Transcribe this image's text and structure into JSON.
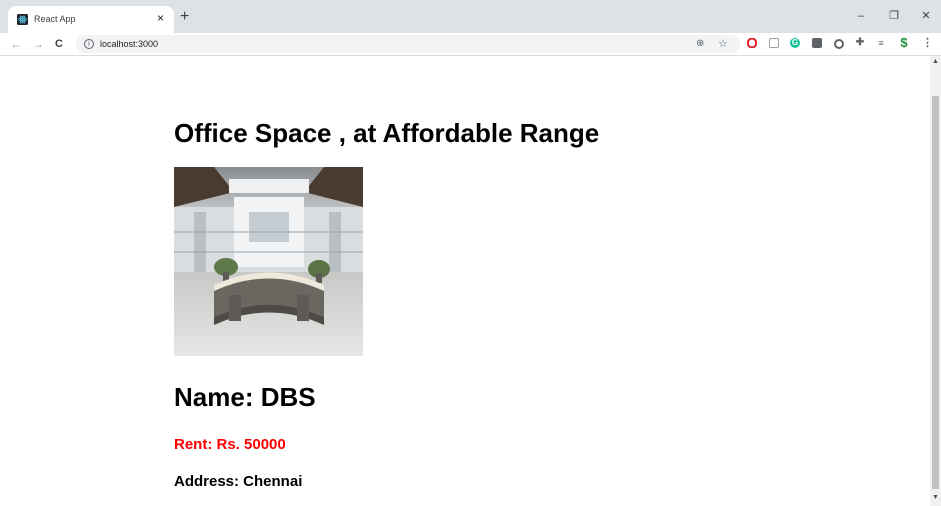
{
  "browser": {
    "tab_title": "React App",
    "tab_close": "×",
    "new_tab": "+",
    "url": "localhost:3000",
    "window": {
      "minimize": "–",
      "restore": "❐",
      "close": "✕"
    },
    "nav": {
      "back": "←",
      "forward": "→",
      "reload": "C"
    },
    "omnibox_icons": {
      "zoom": "⊕",
      "bookmark": "☆"
    },
    "menu": "⋮"
  },
  "page": {
    "heading": "Office Space , at Affordable Range",
    "name": "Name: DBS",
    "rent": "Rent: Rs. 50000",
    "address": "Address: Chennai",
    "rent_color": "#ff0000"
  },
  "scrollbar": {
    "up": "▲",
    "down": "▼"
  }
}
